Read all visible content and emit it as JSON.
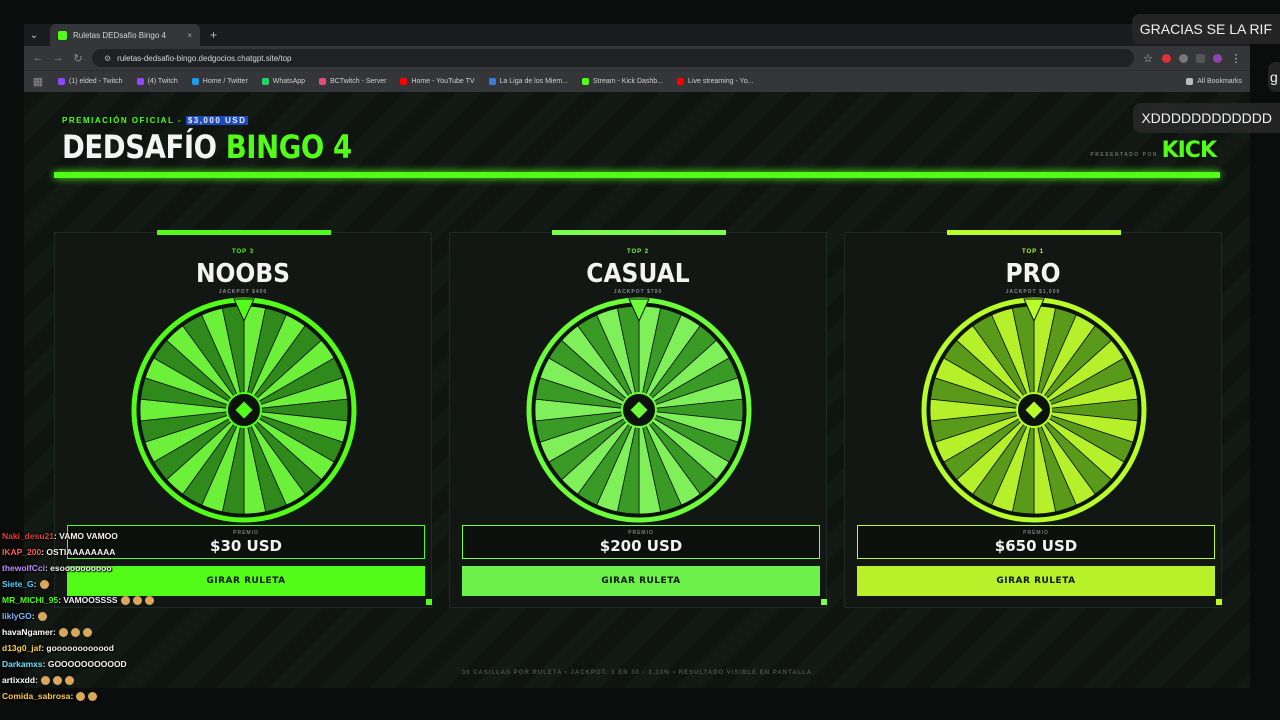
{
  "browser": {
    "tab_title": "Ruletas DEDsafío Bingo 4",
    "new_tab": "+",
    "url": "ruletas-dedsafio-bingo.dedgocios.chatgpt.site/top",
    "bookmarks": [
      {
        "label": "(1) elded - Twitch",
        "color": "#9146ff"
      },
      {
        "label": "(4) Twitch",
        "color": "#9146ff"
      },
      {
        "label": "Home / Twitter",
        "color": "#1d9bf0"
      },
      {
        "label": "WhatsApp",
        "color": "#25d366"
      },
      {
        "label": "BCTwitch - Server",
        "color": "#e34b7a"
      },
      {
        "label": "Home - YouTube TV",
        "color": "#ff0000"
      },
      {
        "label": "La Liga de los Miem...",
        "color": "#3a7bd5"
      },
      {
        "label": "Stream - Kick Dashb...",
        "color": "#53fc18"
      },
      {
        "label": "Live streaming - Yo...",
        "color": "#ff0000"
      }
    ],
    "all_bookmarks": "All Bookmarks"
  },
  "header": {
    "premiacion_label": "PREMIACIÓN OFICIAL -",
    "premiacion_amount": "$3,000 USD",
    "title_white": "DEDSAFÍO",
    "title_green": "BINGO 4",
    "presented_by": "PRESENTADO POR",
    "brand": "KICK"
  },
  "cards": [
    {
      "rank": "TOP 3",
      "name": "NOOBS",
      "jackpot": "JACKPOT $400",
      "premio_label": "PREMIO",
      "premio_value": "$30 USD",
      "button": "GIRAR RULETA",
      "accent": "#53fc18",
      "light": "#6cf03a",
      "dark": "#2f8a1b",
      "rim": "#53fc18",
      "btn": "#53fc18"
    },
    {
      "rank": "TOP 2",
      "name": "CASUAL",
      "jackpot": "JACKPOT $700",
      "premio_label": "PREMIO",
      "premio_value": "$200 USD",
      "button": "GIRAR RULETA",
      "accent": "#7dfc4a",
      "light": "#7ff05a",
      "dark": "#3a9a26",
      "rim": "#6cfc3a",
      "btn": "#6cf04a"
    },
    {
      "rank": "TOP 1",
      "name": "PRO",
      "jackpot": "JACKPOT $1,000",
      "premio_label": "PREMIO",
      "premio_value": "$650 USD",
      "button": "GIRAR RULETA",
      "accent": "#b8fc2a",
      "light": "#b6f02a",
      "dark": "#5a9a1a",
      "rim": "#b8fc2a",
      "btn": "#b8f02a"
    }
  ],
  "footer": "30 CASILLAS POR RULETA  •  JACKPOT: 1 EN 30 - 3.33%  •  RESULTADO VISIBLE EN PANTALLA",
  "overlays": {
    "msg1": "GRACIAS SE LA RIF",
    "msg2": "XDDDDDDDDDDDD",
    "msg3": "g"
  },
  "chat": [
    {
      "user": "Naki_desu21",
      "color": "#e0403a",
      "text": ": VAMO VAMOO",
      "emotes": 0
    },
    {
      "user": "IKAP_200",
      "color": "#ff5a5a",
      "text": ": OSTIAAAAAAAA",
      "emotes": 0
    },
    {
      "user": "thewolfCci",
      "color": "#c08cff",
      "text": ": esoooooooooo",
      "emotes": 0
    },
    {
      "user": "Siete_G",
      "color": "#5ad1ff",
      "text": ":",
      "emotes": 1
    },
    {
      "user": "MR_MICHI_95",
      "color": "#53fc18",
      "text": ": VAMOOSSSS",
      "emotes": 3
    },
    {
      "user": "liklyGO",
      "color": "#8ab4ff",
      "text": ":",
      "emotes": 1
    },
    {
      "user": "havaNgamer",
      "color": "#ffffff",
      "text": ":",
      "emotes": 3
    },
    {
      "user": "d13g0_jaf",
      "color": "#ffd24a",
      "text": ": goooooooooood",
      "emotes": 0
    },
    {
      "user": "Darkamxs",
      "color": "#6ee0ff",
      "text": ": GOOOOOOOOOOD",
      "emotes": 0
    },
    {
      "user": "artixxdd",
      "color": "#ffffff",
      "text": ":",
      "emotes": 3
    },
    {
      "user": "Comida_sabrosa",
      "color": "#ffc94a",
      "text": ":",
      "emotes": 2
    }
  ]
}
